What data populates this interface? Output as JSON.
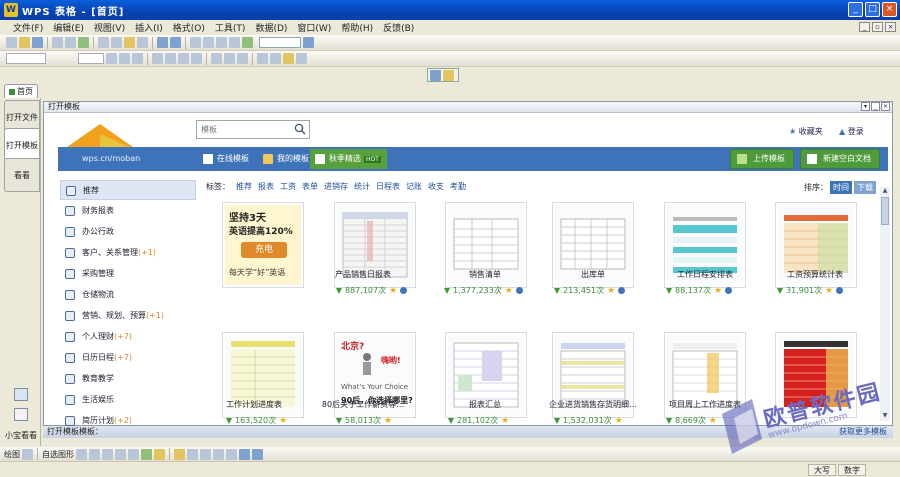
{
  "window": {
    "title": "WPS 表格 - [首页]"
  },
  "menus": [
    "文件(F)",
    "编辑(E)",
    "视图(V)",
    "插入(I)",
    "格式(O)",
    "工具(T)",
    "数据(D)",
    "窗口(W)",
    "帮助(H)",
    "反馈(B)"
  ],
  "doc_tab": "首页",
  "side_tabs": [
    "打开文件",
    "打开模板",
    "看看"
  ],
  "side_footer": "小宝看看",
  "panel_title": "打开模板",
  "search": {
    "placeholder": "模板"
  },
  "favorites": "收藏夹",
  "login": "登录",
  "url": "wps.cn/moban",
  "nav_tabs": [
    "在线模板",
    "我的模板",
    "秋季精选"
  ],
  "hot": "HOT",
  "upload_btn": "上传模板",
  "new_btn": "新建空白文档",
  "categories": [
    {
      "label": "推荐",
      "count": ""
    },
    {
      "label": "财务报表",
      "count": ""
    },
    {
      "label": "办公行政",
      "count": ""
    },
    {
      "label": "客户、关系管理",
      "count": "(+1)"
    },
    {
      "label": "采购管理",
      "count": ""
    },
    {
      "label": "仓储物流",
      "count": ""
    },
    {
      "label": "营销、规划、预算",
      "count": "(+1)"
    },
    {
      "label": "个人理财",
      "count": "(+7)"
    },
    {
      "label": "日历日程",
      "count": "(+7)"
    },
    {
      "label": "教育教学",
      "count": ""
    },
    {
      "label": "生活娱乐",
      "count": ""
    },
    {
      "label": "简历计划",
      "count": "(+2)"
    }
  ],
  "filter_label": "标签：",
  "tags": [
    "推荐",
    "报表",
    "工资",
    "表单",
    "进销存",
    "统计",
    "日程表",
    "记账",
    "收支",
    "考勤"
  ],
  "sort": {
    "label": "排序：",
    "time": "时间",
    "downloads": "下载"
  },
  "cards_row1": [
    {
      "title": "",
      "downloads": ""
    },
    {
      "title": "产品销售日报表",
      "downloads": "887,107次"
    },
    {
      "title": "销售清单",
      "downloads": "1,377,233次"
    },
    {
      "title": "出库单",
      "downloads": "213,451次"
    },
    {
      "title": "工作日程安排表",
      "downloads": "88,137次"
    },
    {
      "title": "工资预算统计表",
      "downloads": "31,901次"
    }
  ],
  "cards_row2": [
    {
      "title": "工作计划进度表",
      "downloads": "163,520次"
    },
    {
      "title": "80后关于工作薪资等…",
      "downloads": "58,013次"
    },
    {
      "title": "报表汇总",
      "downloads": "281,102次"
    },
    {
      "title": "企业进货销售存货明细…",
      "downloads": "1,532,031次"
    },
    {
      "title": "项目周上工作进度表",
      "downloads": "8,669次"
    },
    {
      "title": "",
      "downloads": ""
    }
  ],
  "promo": {
    "line1": "坚持3天",
    "line2": "英语提高120%",
    "button": "充电",
    "line3": "每天学“好”英语"
  },
  "card_b2": {
    "text1": "北京?",
    "text2": "嗨哟!",
    "text3": "What's Your Choice",
    "text4": "90后，你选择哪里?"
  },
  "status": {
    "left": "打开模板模板：",
    "right": "获取更多模板"
  },
  "bottom_toolbar": {
    "label1": "绘图",
    "label2": "自选图形"
  },
  "winstatus": [
    "大写",
    "数字"
  ],
  "watermark": {
    "text": "欧普软件园",
    "url": "www.opdown.com"
  }
}
